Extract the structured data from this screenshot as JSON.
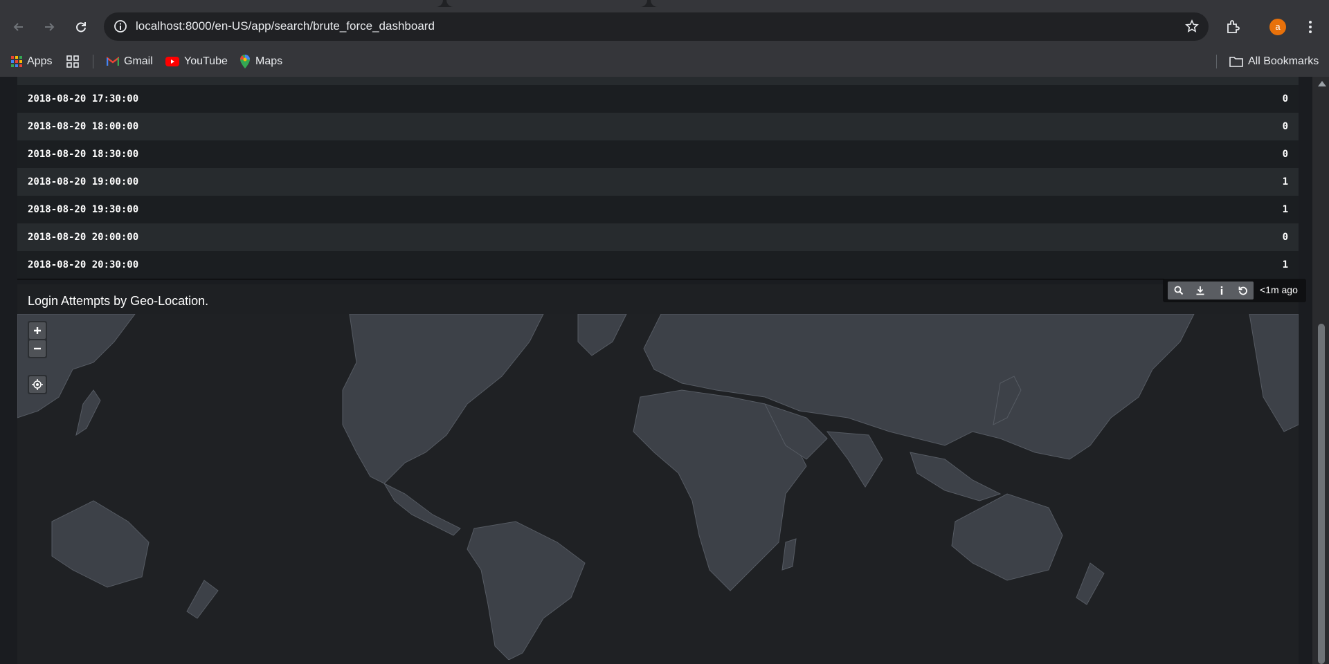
{
  "browser": {
    "url": "localhost:8000/en-US/app/search/brute_force_dashboard",
    "avatar_letter": "a",
    "bookmarks": [
      {
        "label": "Apps",
        "icon": "apps-grid-icon"
      },
      {
        "label": "",
        "icon": "tab-groups-icon"
      },
      {
        "label": "Gmail",
        "icon": "gmail-icon"
      },
      {
        "label": "YouTube",
        "icon": "youtube-icon"
      },
      {
        "label": "Maps",
        "icon": "maps-icon"
      }
    ],
    "all_bookmarks_label": "All Bookmarks",
    "accent_color": "#e8710a"
  },
  "table": {
    "rows": [
      {
        "time": "2018-08-20 17:30:00",
        "count": "0"
      },
      {
        "time": "2018-08-20 18:00:00",
        "count": "0"
      },
      {
        "time": "2018-08-20 18:30:00",
        "count": "0"
      },
      {
        "time": "2018-08-20 19:00:00",
        "count": "1"
      },
      {
        "time": "2018-08-20 19:30:00",
        "count": "1"
      },
      {
        "time": "2018-08-20 20:00:00",
        "count": "0"
      },
      {
        "time": "2018-08-20 20:30:00",
        "count": "1"
      }
    ]
  },
  "panel": {
    "title": "Login Attempts by Geo-Location.",
    "refresh_time": "<1m ago",
    "toolbar_icons": [
      "search-icon",
      "export-icon",
      "info-icon",
      "refresh-icon"
    ]
  },
  "map": {
    "land_color": "#3d4148",
    "border_color": "#565b63",
    "controls": [
      "zoom-in-icon",
      "zoom-out-icon",
      "locate-icon"
    ]
  }
}
